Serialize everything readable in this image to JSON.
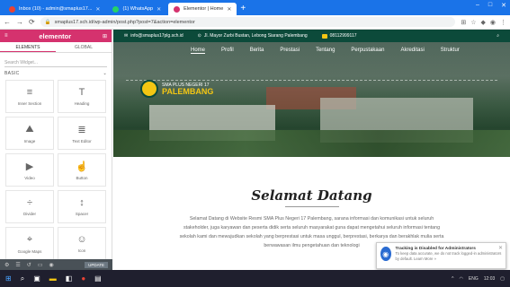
{
  "browser": {
    "tabs": [
      {
        "label": "Inbox (10) - admin@smaplus17...",
        "color": "#ea4335",
        "active": false
      },
      {
        "label": "(1) WhatsApp",
        "color": "#25d366",
        "active": false
      },
      {
        "label": "Elementor | Home",
        "color": "#d5326e",
        "active": true
      }
    ],
    "url": "smaplus17.sch.id/wp-admin/post.php?post=7&action=elementor",
    "window_controls": [
      "–",
      "□",
      "✕"
    ]
  },
  "elementor": {
    "logo": "elementor",
    "tabs": [
      "ELEMENTS",
      "GLOBAL"
    ],
    "search_placeholder": "Search Widget...",
    "category": "BASIC",
    "widgets": [
      {
        "icon": "≡",
        "label": "Inner Section"
      },
      {
        "icon": "T",
        "label": "Heading"
      },
      {
        "icon": "⛰",
        "label": "Image"
      },
      {
        "icon": "≣",
        "label": "Text Editor"
      },
      {
        "icon": "▶",
        "label": "Video"
      },
      {
        "icon": "☝",
        "label": "Button"
      },
      {
        "icon": "÷",
        "label": "Divider"
      },
      {
        "icon": "↕",
        "label": "Spacer"
      },
      {
        "icon": "⌖",
        "label": "Google Maps"
      },
      {
        "icon": "☺",
        "label": "Icon"
      }
    ],
    "footer": {
      "update_label": "UPDATE"
    }
  },
  "site": {
    "topbar": {
      "email": "info@smaplus17plg.sch.id",
      "address": "Jl. Mayor Zurbi Bustan, Lebong Siarang Palembang",
      "phone": "08112999117"
    },
    "menu": [
      "Home",
      "Profil",
      "Berita",
      "Prestasi",
      "Tentang",
      "Perpustakaan",
      "Akreditasi",
      "Struktur"
    ],
    "menu_active": "Home",
    "brand_small": "SMA PLUS NEGERI 17",
    "brand_big": "PALEMBANG",
    "welcome_title": "Selamat Datang",
    "welcome_text": "Selamat Datang di Website Resmi SMA Plus Negeri 17 Palembang, sarana informasi dan komunikasi untuk seluruh stakeholder, juga karyawan dan peserta didik serta seluruh masyarakat guna dapat mengetahui seluruh informasi tentang sekolah kami dan mewujudkan sekolah yang berprestasi untuk masa unggul, berprestasi, berkarya dan berakhlak mulia serta berwawasan ilmu pengetahuan dan teknologi"
  },
  "notification": {
    "title": "Tracking is Disabled for Administrators",
    "text": "To keep data accurate, we do not track logged-in administrators by default. Learn More »"
  },
  "taskbar": {
    "time": "12:03",
    "lang": "ENG"
  }
}
